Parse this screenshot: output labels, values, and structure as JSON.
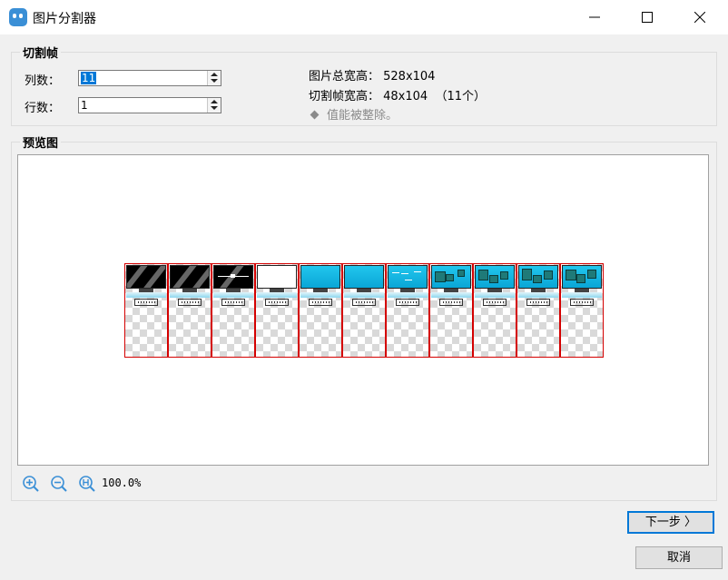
{
  "window": {
    "title": "图片分割器",
    "icon": "app-icon"
  },
  "split_frames": {
    "title": "切割帧",
    "columns_label": "列数：",
    "columns_value": "11",
    "rows_label": "行数：",
    "rows_value": "1",
    "total_size_line": "图片总宽高： 528x104",
    "frame_size_line": "切割帧宽高： 48x104  （11个）",
    "note": "值能被整除。"
  },
  "preview": {
    "title": "预览图",
    "frame_count": 11,
    "zoom_level": "100.0%"
  },
  "buttons": {
    "next": "下一步 〉",
    "cancel": "取消"
  },
  "colors": {
    "accent": "#0078d7",
    "frame_border": "#d40000",
    "screen_cyan": "#21c6ee"
  }
}
